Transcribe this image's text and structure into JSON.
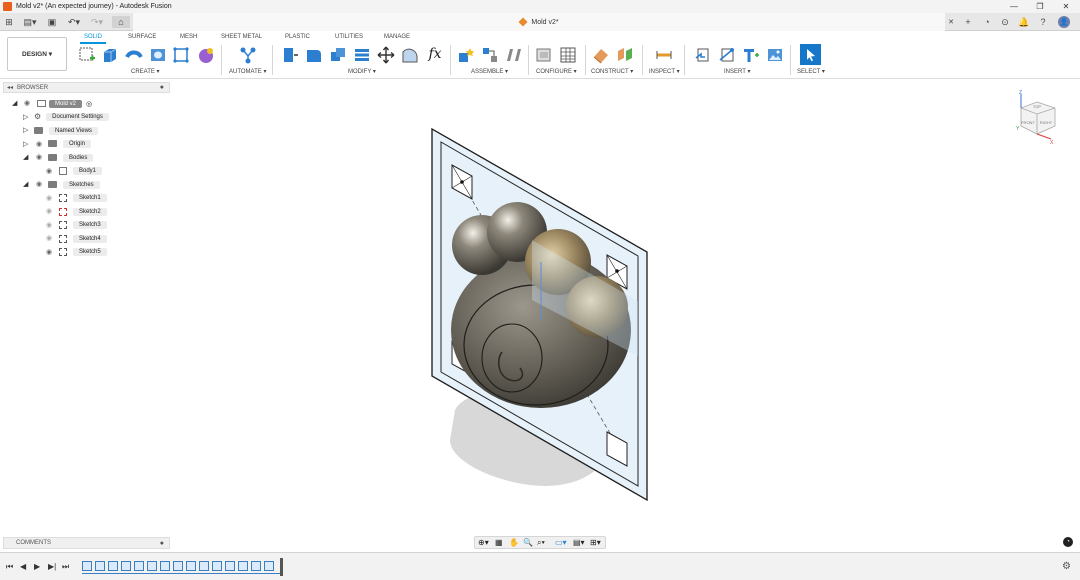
{
  "window": {
    "title": "Mold v2* (An expected journey) - Autodesk Fusion",
    "document_tab": "Mold v2*",
    "controls": [
      "—",
      "❐",
      "✕"
    ]
  },
  "workspace": {
    "label": "DESIGN ▾"
  },
  "menu_tabs": [
    {
      "label": "SOLID",
      "active": true
    },
    {
      "label": "SURFACE",
      "active": false
    },
    {
      "label": "MESH",
      "active": false
    },
    {
      "label": "SHEET METAL",
      "active": false
    },
    {
      "label": "PLASTIC",
      "active": false
    },
    {
      "label": "UTILITIES",
      "active": false
    },
    {
      "label": "MANAGE",
      "active": false
    }
  ],
  "tool_groups": [
    {
      "label": "CREATE ▾"
    },
    {
      "label": "AUTOMATE ▾"
    },
    {
      "label": "MODIFY ▾"
    },
    {
      "label": "ASSEMBLE ▾"
    },
    {
      "label": "CONFIGURE ▾"
    },
    {
      "label": "CONSTRUCT ▾"
    },
    {
      "label": "INSPECT ▾"
    },
    {
      "label": "INSERT ▾"
    },
    {
      "label": "SELECT ▾"
    }
  ],
  "browser": {
    "header": "BROWSER",
    "root": "Mold v2",
    "items": [
      {
        "label": "Document Settings"
      },
      {
        "label": "Named Views"
      },
      {
        "label": "Origin"
      },
      {
        "label": "Bodies"
      },
      {
        "label": "Body1"
      },
      {
        "label": "Sketches"
      },
      {
        "label": "Sketch1"
      },
      {
        "label": "Sketch2"
      },
      {
        "label": "Sketch3"
      },
      {
        "label": "Sketch4"
      },
      {
        "label": "Sketch5"
      }
    ]
  },
  "comments": {
    "label": "COMMENTS"
  },
  "viewcube": {
    "faces": [
      "TOP",
      "FRONT",
      "RIGHT"
    ],
    "axes": [
      "Z",
      "Y",
      "X"
    ]
  },
  "colors": {
    "accent": "#0696d7",
    "body": "#5f5b52",
    "sketch_plane": "#cfe6f5"
  }
}
